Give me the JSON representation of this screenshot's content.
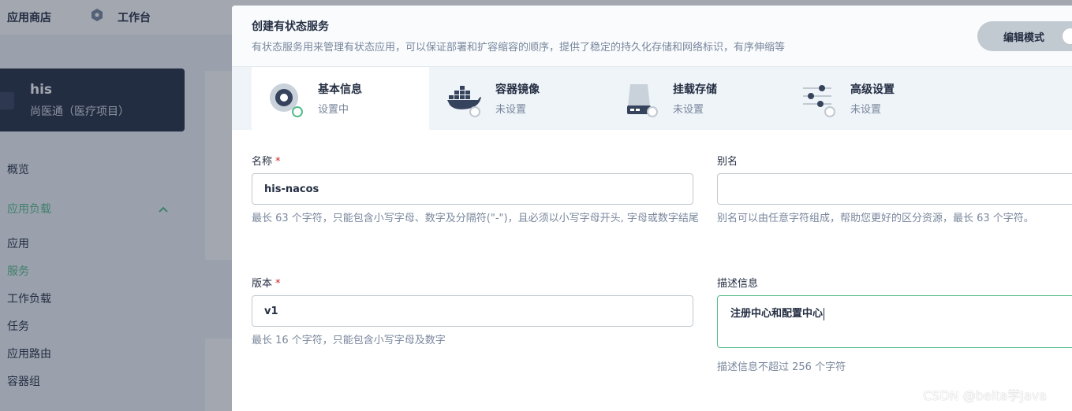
{
  "topbar": {
    "app_store": "应用商店",
    "workbench": "工作台"
  },
  "project": {
    "name": "his",
    "subtitle": "尚医通（医疗项目）"
  },
  "sidebar": {
    "overview": "概览",
    "group_title": "应用负载",
    "items": [
      {
        "label": "应用"
      },
      {
        "label": "服务"
      },
      {
        "label": "工作负载"
      },
      {
        "label": "任务"
      },
      {
        "label": "应用路由"
      },
      {
        "label": "容器组"
      }
    ],
    "active_color": "#55bc8a"
  },
  "modal": {
    "title": "创建有状态服务",
    "description": "有状态服务用来管理有状态应用，可以保证部署和扩容缩容的顺序，提供了稳定的持久化存储和网络标识，有序伸缩等",
    "edit_mode_label": "编辑模式",
    "tabs": [
      {
        "title": "基本信息",
        "status": "设置中",
        "icon": "gear-icon"
      },
      {
        "title": "容器镜像",
        "status": "未设置",
        "icon": "docker-icon"
      },
      {
        "title": "挂载存储",
        "status": "未设置",
        "icon": "storage-icon"
      },
      {
        "title": "高级设置",
        "status": "未设置",
        "icon": "sliders-icon"
      }
    ],
    "form": {
      "name_label": "名称",
      "required_mark": "*",
      "name_value": "his-nacos",
      "name_hint": "最长 63 个字符，只能包含小写字母、数字及分隔符(\"-\")，且必须以小写字母开头, 字母或数字结尾",
      "alias_label": "别名",
      "alias_value": "",
      "alias_hint": "别名可以由任意字符组成，帮助您更好的区分资源，最长 63 个字符。",
      "version_label": "版本",
      "version_value": "v1",
      "version_hint": "最长 16 个字符，只能包含小写字母及数字",
      "desc_label": "描述信息",
      "desc_value": "注册中心和配置中心",
      "desc_hint": "描述信息不超过 256 个字符"
    }
  },
  "watermark": "CSDN @beita学Java",
  "colors": {
    "accent": "#55bc8a",
    "dark": "#242e42",
    "required": "#ca2621"
  }
}
